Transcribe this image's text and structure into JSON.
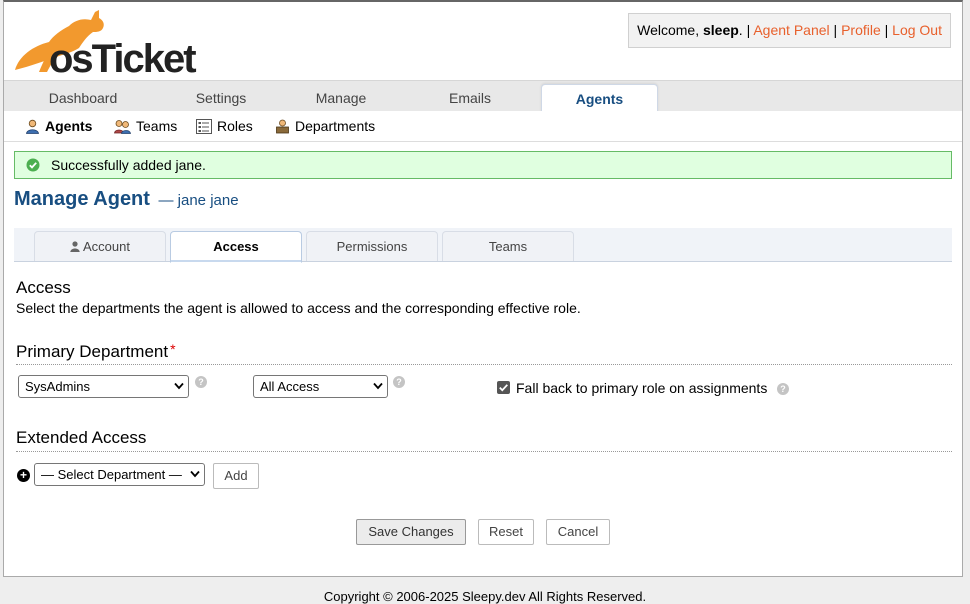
{
  "header": {
    "logo_text": "osTicket",
    "welcome_prefix": "Welcome, ",
    "username": "sleep",
    "welcome_suffix": ". |",
    "links": {
      "agent_panel": "Agent Panel",
      "profile": "Profile",
      "logout": "Log Out"
    },
    "separator": "|"
  },
  "nav": {
    "tabs": [
      {
        "label": "Dashboard"
      },
      {
        "label": "Settings"
      },
      {
        "label": "Manage"
      },
      {
        "label": "Emails"
      },
      {
        "label": "Agents",
        "active": true
      }
    ]
  },
  "subnav": {
    "items": [
      {
        "label": "Agents",
        "icon": "agent-icon",
        "active": true
      },
      {
        "label": "Teams",
        "icon": "teams-icon"
      },
      {
        "label": "Roles",
        "icon": "roles-icon"
      },
      {
        "label": "Departments",
        "icon": "departments-icon"
      }
    ]
  },
  "message": {
    "text": "Successfully added jane."
  },
  "page": {
    "title": "Manage Agent",
    "subtitle": "— jane jane",
    "tabs": [
      {
        "label": "Account",
        "icon": "user-icon"
      },
      {
        "label": "Access",
        "active": true
      },
      {
        "label": "Permissions"
      },
      {
        "label": "Teams"
      }
    ]
  },
  "access": {
    "heading": "Access",
    "description": "Select the departments the agent is allowed to access and the corresponding effective role.",
    "primary": {
      "heading": "Primary Department",
      "required_mark": "*",
      "department_value": "SysAdmins",
      "role_value": "All Access",
      "fallback_label": "Fall back to primary role on assignments",
      "fallback_checked": true
    },
    "extended": {
      "heading": "Extended Access",
      "select_value": "— Select Department —",
      "add_label": "Add"
    }
  },
  "actions": {
    "save": "Save Changes",
    "reset": "Reset",
    "cancel": "Cancel"
  },
  "footer": {
    "text": "Copyright © 2006-2025 Sleepy.dev All Rights Reserved."
  },
  "colors": {
    "link": "#e8602c",
    "brand_blue": "#184e81",
    "logo_orange": "#f2992e",
    "success_bg": "#e0ffe0",
    "success_border": "#66bb66"
  }
}
